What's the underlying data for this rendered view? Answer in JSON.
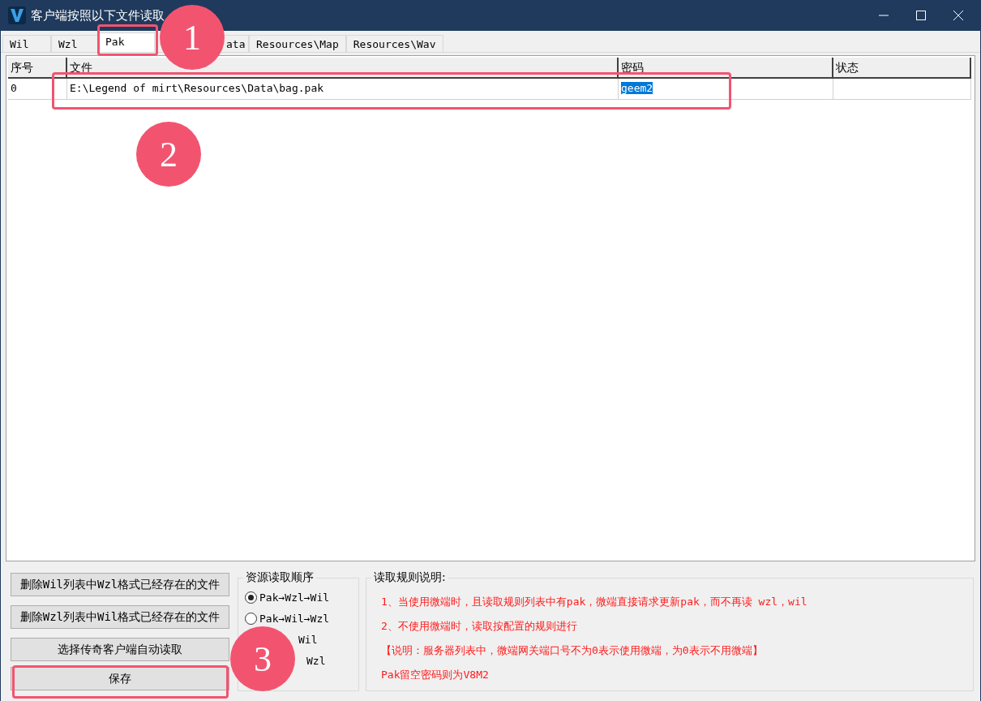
{
  "window": {
    "title": "客户端按照以下文件读取"
  },
  "tabs": [
    {
      "label": "Wil",
      "selected": false
    },
    {
      "label": "Wzl",
      "selected": false
    },
    {
      "label": "Pak",
      "selected": true
    },
    {
      "label": "ata",
      "selected": false
    },
    {
      "label": "Resources\\Map",
      "selected": false
    },
    {
      "label": "Resources\\Wav",
      "selected": false
    }
  ],
  "table": {
    "columns": [
      "序号",
      "文件",
      "密码",
      "状态"
    ],
    "rows": [
      {
        "cells": [
          "0",
          "E:\\Legend of mirt\\Resources\\Data\\bag.pak",
          "geem2",
          ""
        ],
        "password_selected": true
      }
    ]
  },
  "buttons": [
    "删除Wil列表中Wzl格式已经存在的文件",
    "删除Wzl列表中Wil格式已经存在的文件",
    "选择传奇客户端自动读取",
    "保存"
  ],
  "order_group": {
    "title": "资源读取顺序",
    "options": [
      {
        "label": "Pak→Wzl→Wil",
        "selected": true
      },
      {
        "label": "Pak→Wil→Wzl",
        "selected": false
      },
      {
        "label": "Wil"
      },
      {
        "label": "Wzl"
      }
    ]
  },
  "rules_group": {
    "title": "读取规则说明:",
    "lines": [
      "1、当使用微端时，且读取规则列表中有pak，微端直接请求更新pak，而不再读 wzl，wil",
      "2、不使用微端时，读取按配置的规则进行",
      "【说明：服务器列表中，微端网关端口号不为0表示使用微端，为0表示不用微端】",
      "Pak留空密码则为V8M2"
    ]
  },
  "callouts": [
    "1",
    "2",
    "3"
  ]
}
